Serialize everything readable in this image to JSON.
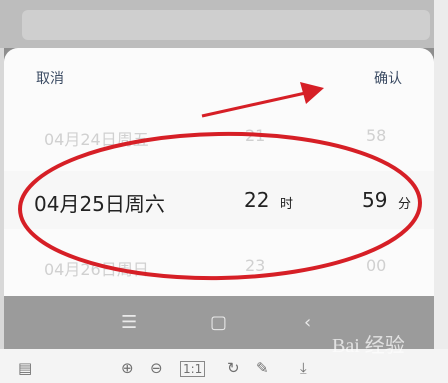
{
  "picker": {
    "cancel_label": "取消",
    "confirm_label": "确认",
    "rows": [
      {
        "date": "04月24日周五",
        "hour": "21",
        "minute": "58"
      },
      {
        "date": "04月25日周六",
        "hour": "22",
        "hour_unit": "时",
        "minute": "59",
        "minute_unit": "分"
      },
      {
        "date": "04月26日周日",
        "hour": "23",
        "minute": "00"
      }
    ]
  },
  "toolbar": {
    "page_indicator": "1:1"
  },
  "watermark": {
    "text": "Bai 经验"
  },
  "colors": {
    "annotation_red": "#d61f26",
    "picker_bg": "#fbfbfb",
    "nav_bar": "#9b9b9b"
  }
}
